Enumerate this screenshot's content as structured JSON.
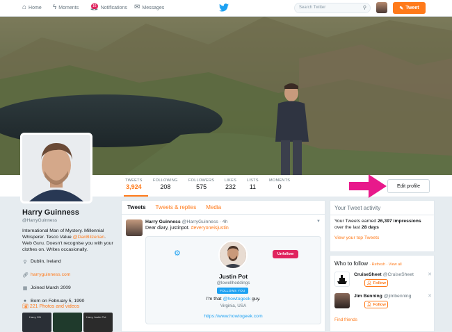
{
  "topnav": {
    "home": "Home",
    "moments": "Moments",
    "notifications": "Notifications",
    "notif_badge": "16",
    "messages": "Messages",
    "search_placeholder": "Search Twitter",
    "tweet_button": "Tweet"
  },
  "stats": [
    {
      "label": "TWEETS",
      "value": "3,924",
      "active": true
    },
    {
      "label": "FOLLOWING",
      "value": "208"
    },
    {
      "label": "FOLLOWERS",
      "value": "575"
    },
    {
      "label": "LIKES",
      "value": "232"
    },
    {
      "label": "LISTS",
      "value": "11"
    },
    {
      "label": "MOMENTS",
      "value": "0"
    }
  ],
  "edit_profile": "Edit profile",
  "profile": {
    "name": "Harry Guinness",
    "handle": "@HarryGuinness",
    "bio_1": "International Man of Mystery. Millennial Whisperer. Tesco Value ",
    "bio_link": "@DanBilzerian",
    "bio_2": ". Web Guru. Doesn't recognise you with your clothes on. Writes occasionally.",
    "location": "Dublin, Ireland",
    "website": "harryguinness.com",
    "joined": "Joined March 2009",
    "born": "Born on February 5, 1990",
    "photos": "221 Photos and videos"
  },
  "tabs": [
    "Tweets",
    "Tweets & replies",
    "Media"
  ],
  "tweet": {
    "name": "Harry Guinness",
    "meta": "@HarryGuinness · 4h",
    "text": "Dear diary, justinpot. ",
    "hashtag": "#everyoneisjustin"
  },
  "card": {
    "unfollow": "Unfollow",
    "name": "Justin Pot",
    "handle": "@lowellheddings",
    "follows_you": "FOLLOWS YOU",
    "bio_1": "I'm that ",
    "bio_link": "@howtogeek",
    "bio_2": " guy.",
    "location": "Virginia, USA",
    "url": "https://www.howtogeek.com"
  },
  "activity": {
    "title": "Your Tweet activity",
    "text_1": "Your Tweets earned ",
    "impressions": "26,397 impressions",
    "text_2": "over the last ",
    "days": "28 days",
    "link": "View your top Tweets"
  },
  "who_to_follow": {
    "title": "Who to follow",
    "refresh": "Refresh",
    "view_all": "View all",
    "items": [
      {
        "name": "CruiseSheet",
        "handle": "@CruiseSheet",
        "follow": "Follow"
      },
      {
        "name": "Jim Benning",
        "handle": "@jimbenning",
        "follow": "Follow"
      }
    ],
    "find_friends": "Find friends"
  },
  "thumbs": [
    "Harry GN",
    "",
    "Harry Justin Pot"
  ],
  "colors": {
    "accent": "#ff7a1a",
    "blue": "#1da1f2",
    "arrow": "#e8198b"
  }
}
